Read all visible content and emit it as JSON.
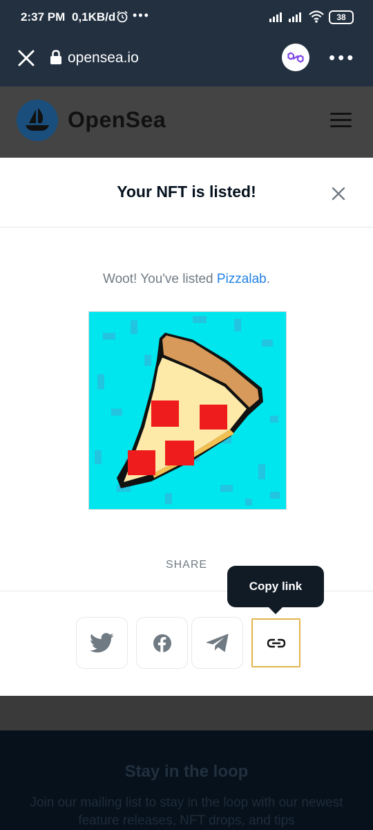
{
  "status_bar": {
    "time": "2:37 PM",
    "net_speed": "0,1KB/d",
    "more_indicator": "•••",
    "battery": "38"
  },
  "browser": {
    "url": "opensea.io",
    "menu_glyph": "•••"
  },
  "site": {
    "brand": "OpenSea"
  },
  "modal": {
    "title": "Your NFT is listed!",
    "message_prefix": "Woot! You've listed ",
    "item_name": "Pizzalab",
    "message_suffix": ".",
    "share_label": "SHARE",
    "tooltip": "Copy link",
    "share_buttons": [
      "twitter-icon",
      "facebook-icon",
      "telegram-icon",
      "link-icon"
    ]
  },
  "footer": {
    "heading": "Stay in the loop",
    "text": "Join our mailing list to stay in the loop with our newest feature releases, NFT drops, and tips"
  },
  "colors": {
    "status_bg": "#223040",
    "brand_blue": "#2081e2",
    "nft_bg": "#00e6ee",
    "active_border": "#e2b44a",
    "tooltip_bg": "#111b26"
  }
}
